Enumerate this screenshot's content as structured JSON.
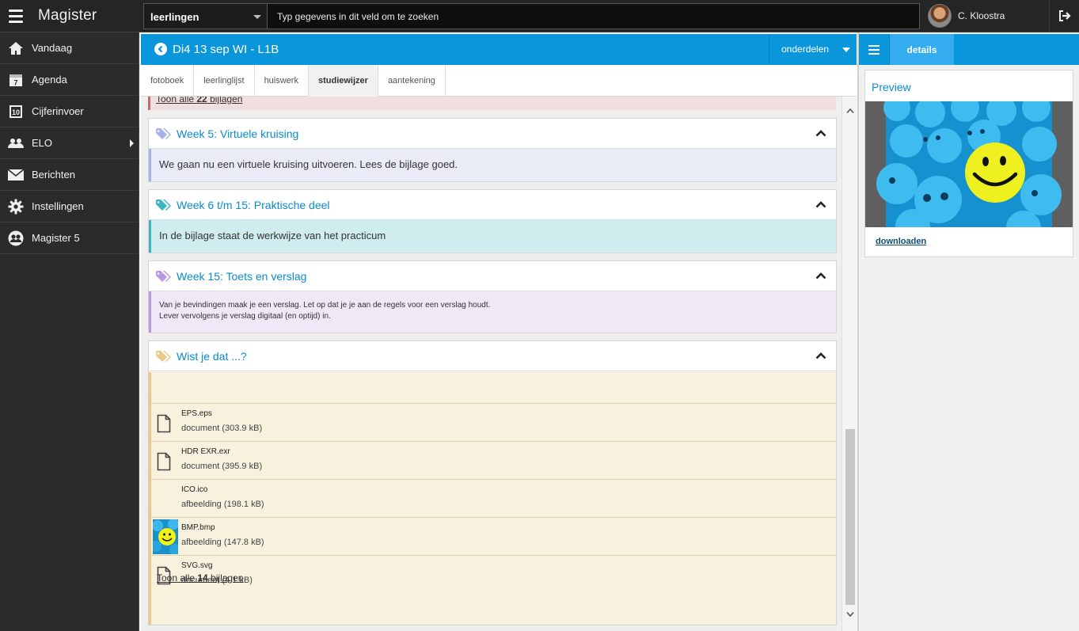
{
  "app": {
    "title": "Magister"
  },
  "search": {
    "scope": "leerlingen",
    "placeholder": "Typ gegevens in dit veld om te zoeken"
  },
  "user": {
    "name": "C. Kloostra"
  },
  "sidebar": {
    "items": [
      {
        "label": "Vandaag",
        "icon": "home-icon"
      },
      {
        "label": "Agenda",
        "icon": "calendar-icon",
        "badge": "7"
      },
      {
        "label": "Cijferinvoer",
        "icon": "grade-icon",
        "badge": "10"
      },
      {
        "label": "ELO",
        "icon": "group-icon"
      },
      {
        "label": "Berichten",
        "icon": "envelope-icon"
      },
      {
        "label": "Instellingen",
        "icon": "gear-icon"
      },
      {
        "label": "Magister 5",
        "icon": "users-circle-icon"
      }
    ]
  },
  "header": {
    "lesson_title": "Di4 13 sep WI - L1B",
    "onderdelen_label": "onderdelen"
  },
  "tabs": [
    {
      "label": "fotoboek",
      "active": false
    },
    {
      "label": "leerlinglijst",
      "active": false
    },
    {
      "label": "huiswerk",
      "active": false
    },
    {
      "label": "studiewijzer",
      "active": true
    },
    {
      "label": "aantekening",
      "active": false
    }
  ],
  "content": {
    "previous_link": {
      "prefix": "Toon alle ",
      "count": "22",
      "suffix": " bijlagen"
    },
    "sections": [
      {
        "title": "Week 5: Virtuele kruising",
        "color": "#a7b3e8",
        "body_bg": "#e9ecf6",
        "body": [
          "We gaan nu een virtuele kruising uitvoeren. Lees de bijlage goed."
        ]
      },
      {
        "title": "Week 6 t/m 15: Praktische deel",
        "color": "#3bb5bf",
        "body_bg": "#cfecee",
        "body": [
          "In de bijlage staat de werkwijze van het practicum"
        ]
      },
      {
        "title": "Week 15: Toets en verslag",
        "color": "#b89ae0",
        "body_bg": "#efe8f7",
        "body": [
          "Van je bevindingen maak je een verslag. Let op dat je je aan de regels voor een verslag houdt.",
          "Lever vervolgens je verslag digitaal (en optijd) in."
        ]
      },
      {
        "title": "Wist je dat ...?",
        "color": "#e9c98a",
        "body_bg": "#f8f1de"
      }
    ],
    "attachments": [
      {
        "name": "EPS.eps",
        "meta": "document (303.9 kB)",
        "icon": "file-icon"
      },
      {
        "name": "HDR EXR.exr",
        "meta": "document (395.9 kB)",
        "icon": "file-icon"
      },
      {
        "name": "ICO.ico",
        "meta": "afbeelding (198.1 kB)",
        "icon": "none"
      },
      {
        "name": "BMP.bmp",
        "meta": "afbeelding (147.8 kB)",
        "icon": "smiley-thumbnail"
      },
      {
        "name": "SVG.svg",
        "meta": "document (4.1 kB)",
        "icon": "file-icon"
      }
    ],
    "show_all": {
      "prefix": "Toon alle ",
      "count": "14",
      "suffix": " bijlagen"
    }
  },
  "right_panel": {
    "details_tab": "details",
    "preview_title": "Preview",
    "download_label": "downloaden"
  },
  "colors": {
    "accent": "#0a96db",
    "sidebar_bg": "#2b2b2b",
    "topbar_bg": "#252525"
  }
}
